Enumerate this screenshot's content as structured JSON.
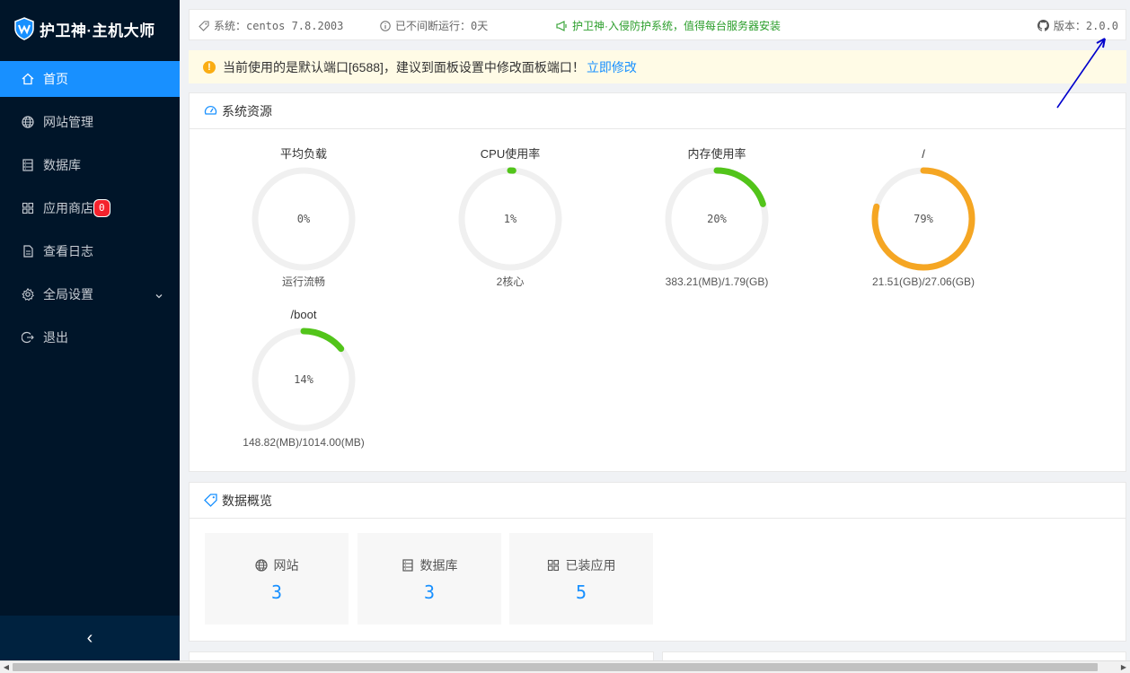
{
  "brand": {
    "title": "护卫神·主机大师"
  },
  "sidebar": {
    "items": [
      {
        "label": "首页",
        "icon": "home-icon",
        "active": true
      },
      {
        "label": "网站管理",
        "icon": "globe-icon"
      },
      {
        "label": "数据库",
        "icon": "database-icon"
      },
      {
        "label": "应用商店",
        "icon": "apps-icon",
        "badge": "0"
      },
      {
        "label": "查看日志",
        "icon": "log-icon"
      },
      {
        "label": "全局设置",
        "icon": "gear-icon",
        "has_submenu": true
      },
      {
        "label": "退出",
        "icon": "logout-icon"
      }
    ],
    "collapse_glyph": "‹"
  },
  "topbar": {
    "system": "系统：centos 7.8.2003",
    "uptime": "已不间断运行：0天",
    "promo": "护卫神·入侵防护系统，值得每台服务器安装",
    "version": "版本：2.0.0"
  },
  "alert": {
    "icon_glyph": "!",
    "text": "当前使用的是默认端口[6588]，建议到面板设置中修改面板端口！",
    "link": "立即修改"
  },
  "resources": {
    "title": "系统资源",
    "gauges": [
      {
        "title": "平均负载",
        "percent": 0,
        "label": "0%",
        "sub": "运行流畅",
        "color": "#52c41a"
      },
      {
        "title": "CPU使用率",
        "percent": 1,
        "label": "1%",
        "sub": "2核心",
        "color": "#52c41a"
      },
      {
        "title": "内存使用率",
        "percent": 20,
        "label": "20%",
        "sub": "383.21(MB)/1.79(GB)",
        "color": "#52c41a"
      },
      {
        "title": "/",
        "percent": 79,
        "label": "79%",
        "sub": "21.51(GB)/27.06(GB)",
        "color": "#f5a623"
      },
      {
        "title": "/boot",
        "percent": 14,
        "label": "14%",
        "sub": "148.82(MB)/1014.00(MB)",
        "color": "#52c41a"
      }
    ]
  },
  "overview": {
    "title": "数据概览",
    "stats": [
      {
        "label": "网站",
        "value": "3",
        "icon": "globe-icon"
      },
      {
        "label": "数据库",
        "value": "3",
        "icon": "database-icon"
      },
      {
        "label": "已装应用",
        "value": "5",
        "icon": "apps-icon"
      }
    ]
  },
  "colors": {
    "sidebar_bg": "#001529",
    "active": "#1890ff",
    "gauge_ok": "#52c41a",
    "gauge_warn": "#f5a623",
    "promo_green": "#2b9e2b",
    "annotation_arrow": "#0000cc"
  }
}
